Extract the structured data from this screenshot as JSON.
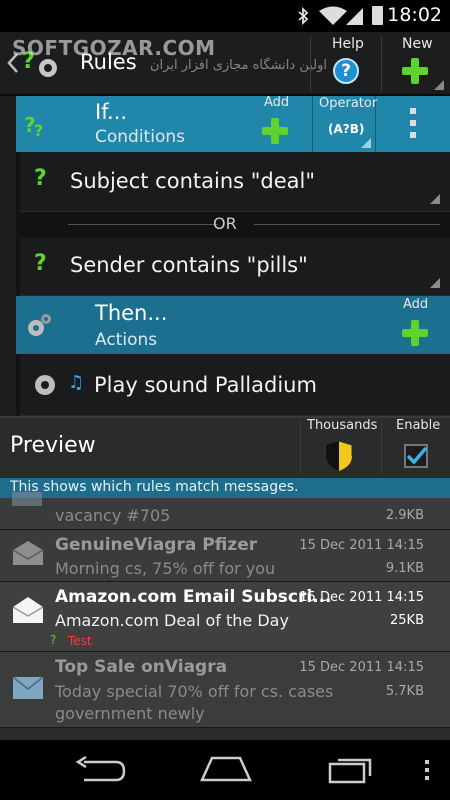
{
  "status_bar": {
    "time": "18:02"
  },
  "watermark": {
    "text": "SOFTGOZAR.COM",
    "subtext": "اولین دانشگاه مجازی افزار ایران"
  },
  "action_bar": {
    "title": "Rules",
    "help_label": "Help",
    "new_label": "New",
    "icons": [
      "back-chevron-icon",
      "rules-app-icon",
      "help-icon",
      "add-icon"
    ]
  },
  "if_block": {
    "title": "If...",
    "subtitle": "Conditions",
    "add_label": "Add",
    "operator_label": "Operator",
    "operator_value": "(A?B)"
  },
  "conditions": [
    {
      "text": "Subject contains \"deal\""
    },
    {
      "text": "Sender contains \"pills\""
    }
  ],
  "or_label": "OR",
  "then_block": {
    "title": "Then...",
    "subtitle": "Actions",
    "add_label": "Add"
  },
  "actions": [
    {
      "text": "Play sound Palladium"
    }
  ],
  "preview": {
    "title": "Preview",
    "thousands_label": "Thousands",
    "enable_label": "Enable",
    "enable_checked": true,
    "info": "This shows which rules match messages."
  },
  "messages": [
    {
      "from": "",
      "subject": "vacancy #705",
      "date": "",
      "size": "2.9KB"
    },
    {
      "from": "GenuineViagra Pfizer",
      "subject": "Morning cs, 75% off for you",
      "date": "15 Dec 2011 14:15",
      "size": "9.1KB"
    },
    {
      "from": "Amazon.com Email Subscri...",
      "subject": "Amazon.com Deal of the Day",
      "date": "15 Dec 2011 14:15",
      "size": "25KB",
      "tag": "Test"
    },
    {
      "from": "Top Sale onViagra",
      "subject": "Today special 70% off for cs. cases",
      "subject2": "government newly",
      "date": "15 Dec 2011 14:15",
      "size": "5.7KB"
    }
  ],
  "colors": {
    "accent_blue": "#1d6f8f",
    "plus_green": "#5fd22e",
    "tag_red": "#ff3b3b"
  }
}
